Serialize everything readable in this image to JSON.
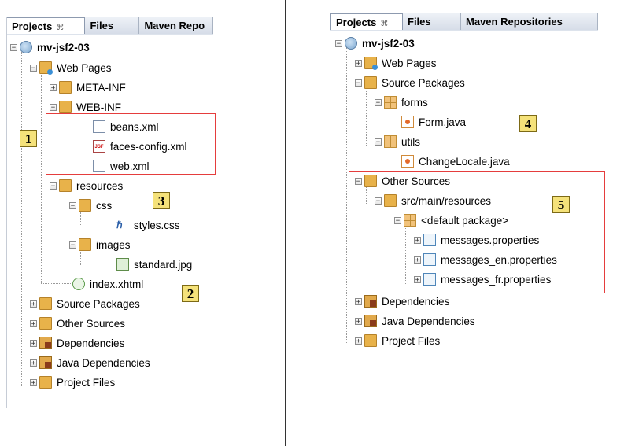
{
  "left": {
    "tabs": [
      {
        "label": "Projects",
        "close": "⌘",
        "active": true
      },
      {
        "label": "Files",
        "active": false
      },
      {
        "label": "Maven Repo",
        "active": false
      }
    ],
    "tree": [
      {
        "label": "mv-jsf2-03",
        "icon": "project-globe-icon",
        "toggle": "−",
        "bold": true
      },
      {
        "label": "Web Pages",
        "icon": "web-folder-icon",
        "toggle": "−"
      },
      {
        "label": "META-INF",
        "icon": "folder-icon",
        "toggle": "+"
      },
      {
        "label": "WEB-INF",
        "icon": "folder-icon",
        "toggle": "−"
      },
      {
        "label": "beans.xml",
        "icon": "xml-file-icon"
      },
      {
        "label": "faces-config.xml",
        "icon": "jsf-file-icon"
      },
      {
        "label": "web.xml",
        "icon": "web-xml-file-icon"
      },
      {
        "label": "resources",
        "icon": "folder-icon",
        "toggle": "−"
      },
      {
        "label": "css",
        "icon": "folder-icon",
        "toggle": "−"
      },
      {
        "label": "styles.css",
        "icon": "css-file-icon"
      },
      {
        "label": "images",
        "icon": "folder-icon",
        "toggle": "−"
      },
      {
        "label": "standard.jpg",
        "icon": "image-file-icon"
      },
      {
        "label": "index.xhtml",
        "icon": "xhtml-file-icon"
      },
      {
        "label": "Source Packages",
        "icon": "source-folder-icon",
        "toggle": "+"
      },
      {
        "label": "Other Sources",
        "icon": "source-folder-icon",
        "toggle": "+"
      },
      {
        "label": "Dependencies",
        "icon": "jar-folder-icon",
        "toggle": "+"
      },
      {
        "label": "Java Dependencies",
        "icon": "jar-folder-icon",
        "toggle": "+"
      },
      {
        "label": "Project Files",
        "icon": "project-files-icon",
        "toggle": "+"
      }
    ],
    "badges": [
      "1",
      "2",
      "3"
    ]
  },
  "right": {
    "tabs": [
      {
        "label": "Projects",
        "close": "⌘",
        "active": true
      },
      {
        "label": "Files",
        "active": false
      },
      {
        "label": "Maven Repositories",
        "active": false
      }
    ],
    "tree": [
      {
        "label": "mv-jsf2-03",
        "icon": "project-globe-icon",
        "toggle": "−",
        "bold": true
      },
      {
        "label": "Web Pages",
        "icon": "web-folder-icon",
        "toggle": "+"
      },
      {
        "label": "Source Packages",
        "icon": "source-folder-icon",
        "toggle": "−"
      },
      {
        "label": "forms",
        "icon": "package-icon",
        "toggle": "−"
      },
      {
        "label": "Form.java",
        "icon": "java-file-icon"
      },
      {
        "label": "utils",
        "icon": "package-icon",
        "toggle": "−"
      },
      {
        "label": "ChangeLocale.java",
        "icon": "java-file-icon"
      },
      {
        "label": "Other Sources",
        "icon": "source-folder-icon",
        "toggle": "−"
      },
      {
        "label": "src/main/resources",
        "icon": "source-folder-icon",
        "toggle": "−"
      },
      {
        "label": "<default package>",
        "icon": "package-icon",
        "toggle": "−"
      },
      {
        "label": "messages.properties",
        "icon": "properties-file-icon",
        "toggle": "+"
      },
      {
        "label": "messages_en.properties",
        "icon": "properties-file-icon",
        "toggle": "+"
      },
      {
        "label": "messages_fr.properties",
        "icon": "properties-file-icon",
        "toggle": "+"
      },
      {
        "label": "Dependencies",
        "icon": "jar-folder-icon",
        "toggle": "+"
      },
      {
        "label": "Java Dependencies",
        "icon": "jar-folder-icon",
        "toggle": "+"
      },
      {
        "label": "Project Files",
        "icon": "project-files-icon",
        "toggle": "+"
      }
    ],
    "badges": [
      "4",
      "5"
    ]
  },
  "colors": {
    "highlight_box": "#e53d3d",
    "badge_fill": "#f5e27a"
  }
}
